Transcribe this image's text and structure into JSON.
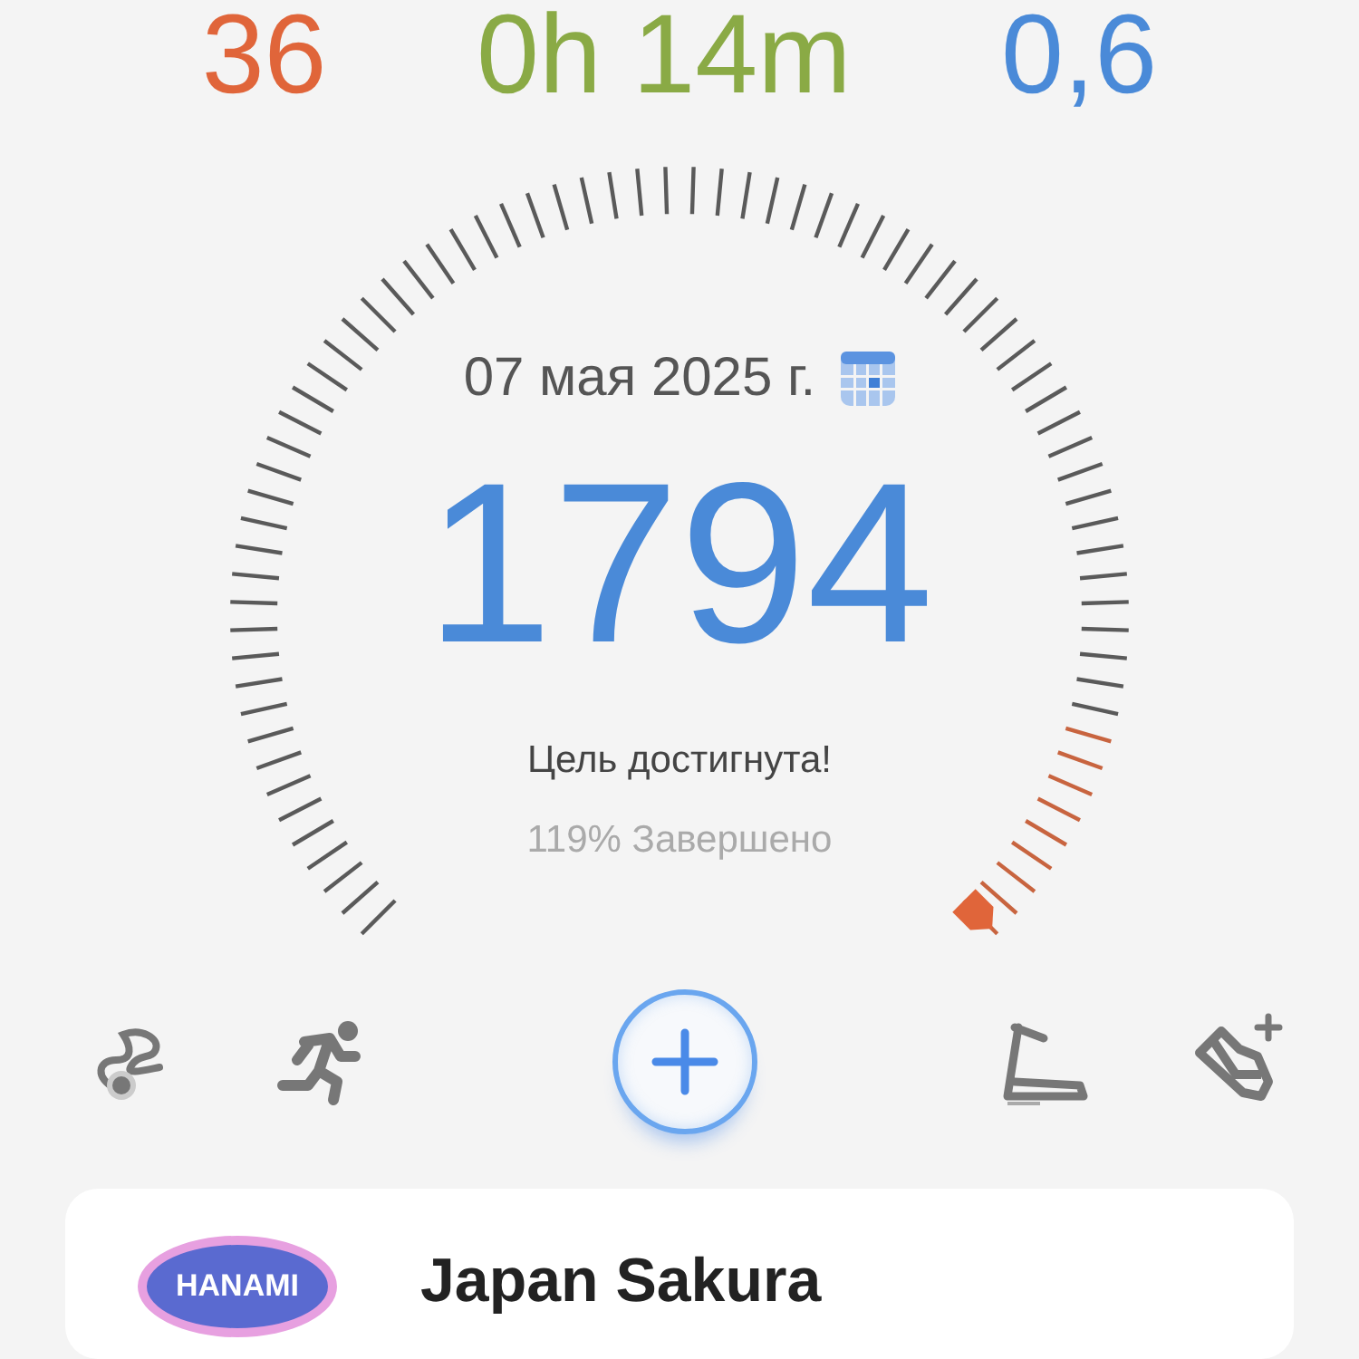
{
  "stats": [
    {
      "value": "36",
      "color": "#e0653a"
    },
    {
      "value": "0h 14m",
      "color": "#8aaa45"
    },
    {
      "value": "0,6",
      "color": "#4a8ad8"
    }
  ],
  "gauge": {
    "date": "07 мая 2025 г.",
    "steps": "1794",
    "status": "Цель достигнута!",
    "percent": "119% Завершено"
  },
  "card": {
    "logo": "HANAMI",
    "title": "Japan Sakura"
  }
}
